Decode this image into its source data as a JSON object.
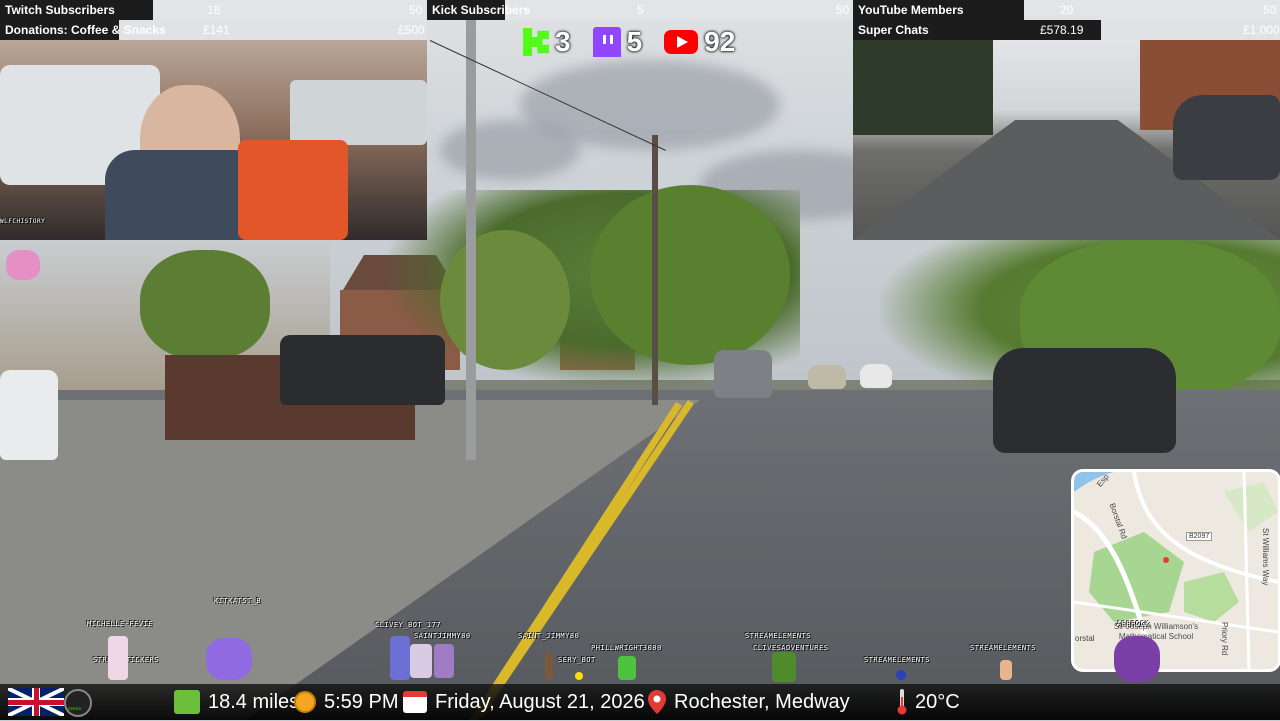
{
  "top_bars": {
    "left": {
      "row1": {
        "label": "Twitch Subscribers",
        "current": "18",
        "goal": "50",
        "progress": 0.36
      },
      "row2": {
        "label": "Donations: Coffee & Snacks",
        "current": "£141",
        "goal": "£500",
        "progress": 0.28
      }
    },
    "middle": {
      "row1": {
        "label": "Kick Subscribers",
        "current": "5",
        "goal": "50",
        "progress": 0.1
      }
    },
    "right": {
      "row1": {
        "label": "YouTube Members",
        "current": "20",
        "goal": "50",
        "progress": 0.4
      },
      "row2": {
        "label": "Super Chats",
        "current": "£578.19",
        "goal": "£1,000",
        "progress": 0.58
      }
    }
  },
  "platform_counts": {
    "kick": "3",
    "twitch": "5",
    "youtube": "92"
  },
  "webcam": {
    "watermark": "WLFCHISTORY"
  },
  "chat_sprites": [
    {
      "name": "MICHELLE-FEVIE"
    },
    {
      "name": "KITKAT5T_B"
    },
    {
      "name": "STREAMSTICKERS"
    },
    {
      "name": "CLIVEY_BOT_177"
    },
    {
      "name": "SAINTJIMMY80"
    },
    {
      "name": "SAINT_JIMMY80"
    },
    {
      "name": "PHILLWRIGHT3080"
    },
    {
      "name": "SERY_BOT"
    },
    {
      "name": "STREAMELEMENTS"
    },
    {
      "name": "CLIVESADVENTURES"
    },
    {
      "name": "STREAMELEMENTS"
    },
    {
      "name": "STREAMELEMENTS"
    },
    {
      "name": "A88ROCK"
    }
  ],
  "map": {
    "labels": {
      "road1": "Borstal Rd",
      "road2": "St Williams Way",
      "road3": "Priory Rd",
      "road_code": "B2097",
      "school": "Sir Joseph Williamson's Mathematical School",
      "place": "orstal",
      "esp": "Esp"
    }
  },
  "bottom_bar": {
    "distance": "18.4 miles",
    "time": "5:59 PM",
    "date": "Friday, August 21, 2026",
    "location": "Rochester, Medway",
    "temperature": "20°C",
    "speed_label": "SPEED"
  },
  "colors": {
    "kick_green": "#53fc18",
    "twitch_purple": "#9146ff",
    "youtube_red": "#ff0000",
    "road_line_yellow": "#d9b92a"
  }
}
